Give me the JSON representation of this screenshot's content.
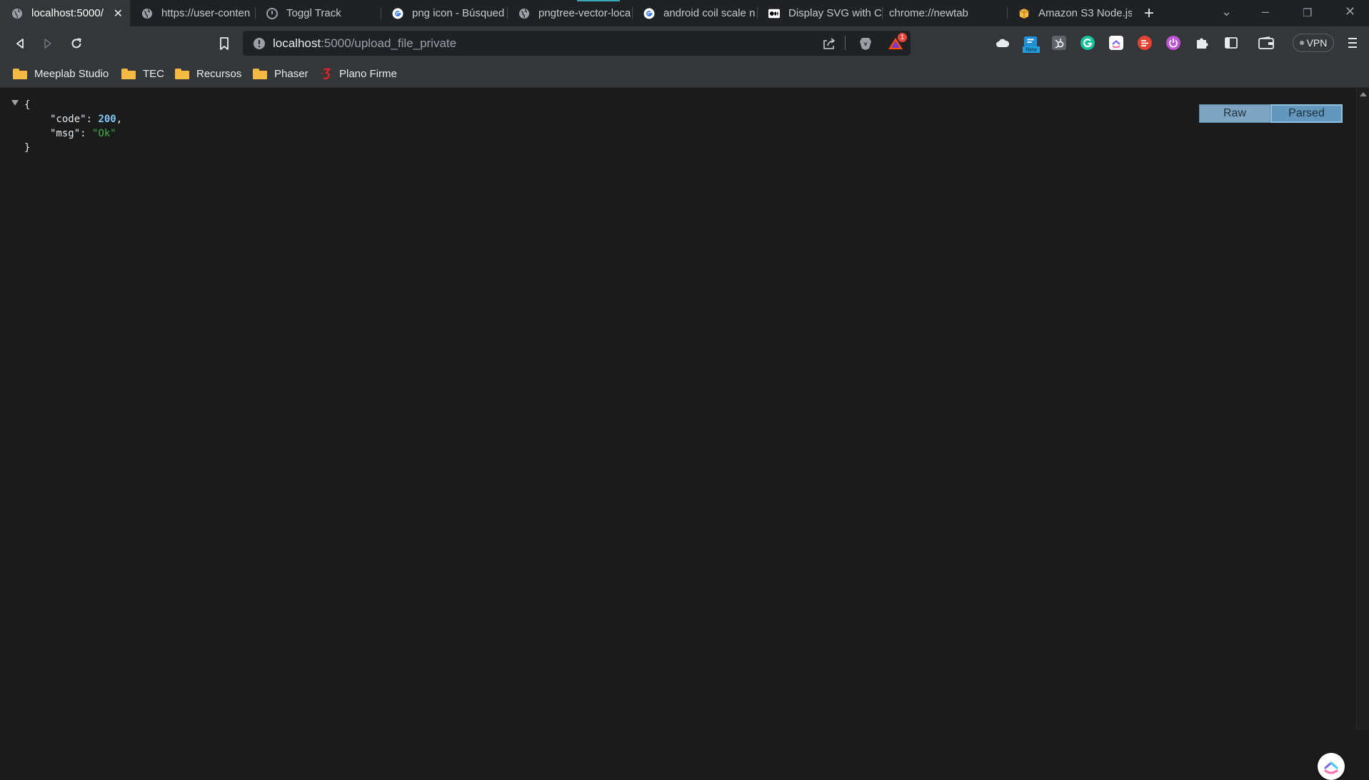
{
  "tabs": [
    {
      "title": "localhost:5000/",
      "icon": "globe-icon",
      "active": true
    },
    {
      "title": "https://user-conten",
      "icon": "globe-icon",
      "active": false
    },
    {
      "title": "Toggl Track",
      "icon": "toggl-icon",
      "active": false
    },
    {
      "title": "png icon - Búsqued",
      "icon": "google-icon",
      "active": false
    },
    {
      "title": "pngtree-vector-loca",
      "icon": "globe-icon",
      "active": false
    },
    {
      "title": "android coil scale n",
      "icon": "google-icon",
      "active": false
    },
    {
      "title": "Display SVG with C",
      "icon": "medium-icon",
      "active": false
    },
    {
      "title": "chrome://newtab",
      "icon": "",
      "active": false
    },
    {
      "title": "Amazon S3 Node.js",
      "icon": "aws-box-icon",
      "active": false
    }
  ],
  "toolbar": {
    "url_host": "localhost",
    "url_path": ":5000/upload_file_private",
    "brave_rewards_badge": "1",
    "vpn_label": "VPN",
    "extension_badge": "New"
  },
  "bookmarks": [
    {
      "label": "Meeplab Studio",
      "icon": "folder-icon"
    },
    {
      "label": "TEC",
      "icon": "folder-icon"
    },
    {
      "label": "Recursos",
      "icon": "folder-icon"
    },
    {
      "label": "Phaser",
      "icon": "folder-icon"
    },
    {
      "label": "Plano Firme",
      "icon": "plano-firme-icon"
    }
  ],
  "json_view": {
    "open_brace": "{",
    "close_brace": "}",
    "entries": [
      {
        "key": "\"code\"",
        "value": "200",
        "type": "number",
        "trailing": ","
      },
      {
        "key": "\"msg\"",
        "value": "\"Ok\"",
        "type": "string",
        "trailing": ""
      }
    ],
    "raw_label": "Raw",
    "parsed_label": "Parsed"
  },
  "colors": {
    "number": "#7fc6f5",
    "string": "#3fae49",
    "background": "#1b1b1b"
  }
}
